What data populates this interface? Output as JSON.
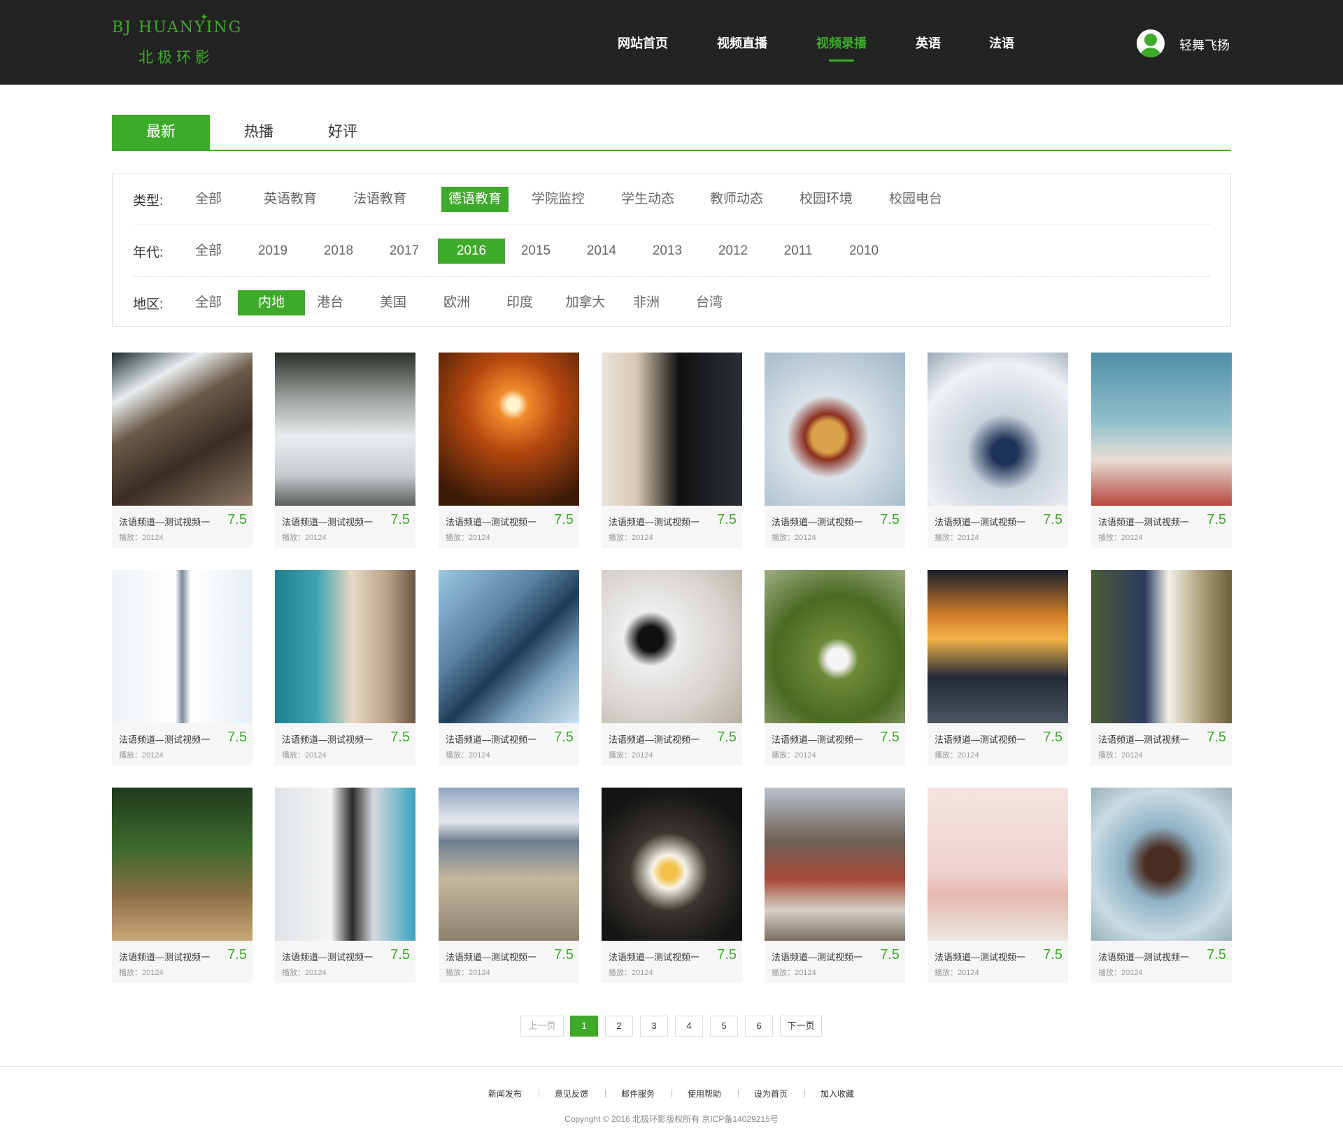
{
  "logo": {
    "en": "BJ HUANYING",
    "cn": "北极环影"
  },
  "nav": [
    "网站首页",
    "视频直播",
    "视频录播",
    "英语",
    "法语"
  ],
  "user": {
    "name": "轻舞飞扬"
  },
  "sort_tabs": [
    "最新",
    "热播",
    "好评"
  ],
  "filters": {
    "type": {
      "label": "类型:",
      "options": [
        "全部",
        "英语教育",
        "法语教育",
        "德语教育",
        "学院监控",
        "学生动态",
        "教师动态",
        "校园环境",
        "校园电台"
      ],
      "selected": "德语教育"
    },
    "year": {
      "label": "年代:",
      "options": [
        "全部",
        "2019",
        "2018",
        "2017",
        "2016",
        "2015",
        "2014",
        "2013",
        "2012",
        "2011",
        "2010"
      ],
      "selected": "2016"
    },
    "region": {
      "label": "地区:",
      "options": [
        "全部",
        "内地",
        "港台",
        "美国",
        "欧洲",
        "印度",
        "加拿大",
        "非洲",
        "台湾"
      ],
      "selected": "内地"
    }
  },
  "videos": [
    {
      "title": "法语频道—测试视频一",
      "score": "7.5",
      "plays": "播放：20124",
      "scene": "coast-rocks"
    },
    {
      "title": "法语频道—测试视频一",
      "score": "7.5",
      "plays": "播放：20124",
      "scene": "frozen-waterfall"
    },
    {
      "title": "法语频道—测试视频一",
      "score": "7.5",
      "plays": "播放：20124",
      "scene": "orange-sunset"
    },
    {
      "title": "法语频道—测试视频一",
      "score": "7.5",
      "plays": "播放：20124",
      "scene": "boy-at-computer"
    },
    {
      "title": "法语频道—测试视频一",
      "score": "7.5",
      "plays": "播放：20124",
      "scene": "burger-in-hand"
    },
    {
      "title": "法语频道—测试视频一",
      "score": "7.5",
      "plays": "播放：20124",
      "scene": "clouds-mountain"
    },
    {
      "title": "法语频道—测试视频一",
      "score": "7.5",
      "plays": "播放：20124",
      "scene": "roller-coaster"
    },
    {
      "title": "法语频道—测试视频一",
      "score": "7.5",
      "plays": "播放：20124",
      "scene": "snow-tower"
    },
    {
      "title": "法语频道—测试视频一",
      "score": "7.5",
      "plays": "播放：20124",
      "scene": "woman-bending"
    },
    {
      "title": "法语频道—测试视频一",
      "score": "7.5",
      "plays": "播放：20124",
      "scene": "skyscraper-glass"
    },
    {
      "title": "法语频道—测试视频一",
      "score": "7.5",
      "plays": "播放：20124",
      "scene": "woodpecker-hand"
    },
    {
      "title": "法语频道—测试视频一",
      "score": "7.5",
      "plays": "播放：20124",
      "scene": "soccer-ball-net"
    },
    {
      "title": "法语频道—测试视频一",
      "score": "7.5",
      "plays": "播放：20124",
      "scene": "city-night"
    },
    {
      "title": "法语频道—测试视频一",
      "score": "7.5",
      "plays": "播放：20124",
      "scene": "wedding-couple"
    },
    {
      "title": "法语频道—测试视频一",
      "score": "7.5",
      "plays": "播放：20124",
      "scene": "jungle-jeep"
    },
    {
      "title": "法语频道—测试视频一",
      "score": "7.5",
      "plays": "播放：20124",
      "scene": "racer-helmet"
    },
    {
      "title": "法语频道—测试视频一",
      "score": "7.5",
      "plays": "播放：20124",
      "scene": "desert-road"
    },
    {
      "title": "法语频道—测试视频一",
      "score": "7.5",
      "plays": "播放：20124",
      "scene": "egg-nest"
    },
    {
      "title": "法语频道—测试视频一",
      "score": "7.5",
      "plays": "播放：20124",
      "scene": "old-town"
    },
    {
      "title": "法语频道—测试视频一",
      "score": "7.5",
      "plays": "播放：20124",
      "scene": "ballet-feet"
    },
    {
      "title": "法语频道—测试视频一",
      "score": "7.5",
      "plays": "播放：20124",
      "scene": "dog-running"
    }
  ],
  "pagination": {
    "prev": "上一页",
    "pages": [
      "1",
      "2",
      "3",
      "4",
      "5",
      "6"
    ],
    "current": "1",
    "next": "下一页"
  },
  "footer": {
    "links": [
      "新闻发布",
      "意见反馈",
      "邮件服务",
      "使用帮助",
      "设为首页",
      "加入收藏"
    ],
    "copyright": "Copyright © 2016 北极环影版权所有 京ICP备14029215号"
  },
  "colors": {
    "accent": "#3eaa2a",
    "header_bg": "#232323"
  }
}
